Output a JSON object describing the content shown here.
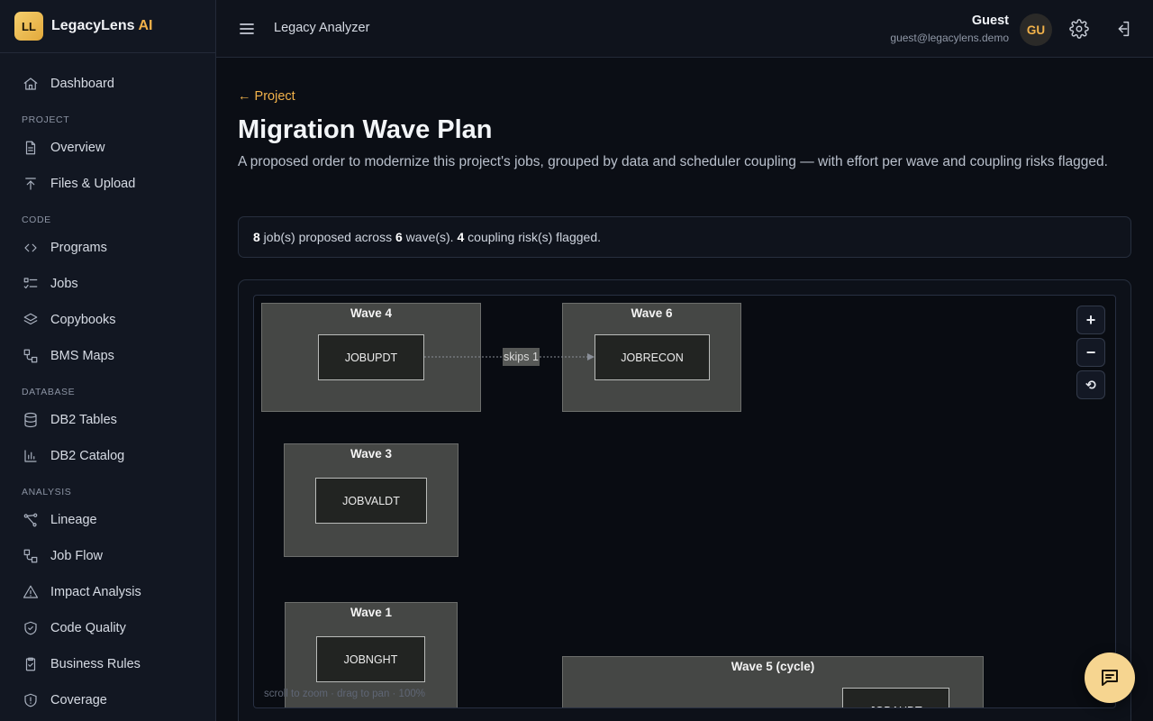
{
  "brand": {
    "logo": "LL",
    "name": "LegacyLens",
    "suffix": "AI"
  },
  "sidebar": {
    "dashboard": "Dashboard",
    "sections": {
      "project": "PROJECT",
      "code": "CODE",
      "database": "DATABASE",
      "analysis": "ANALYSIS"
    },
    "items": {
      "overview": "Overview",
      "files": "Files & Upload",
      "programs": "Programs",
      "jobs": "Jobs",
      "copybooks": "Copybooks",
      "bms": "BMS Maps",
      "db2tables": "DB2 Tables",
      "db2catalog": "DB2 Catalog",
      "lineage": "Lineage",
      "jobflow": "Job Flow",
      "impact": "Impact Analysis",
      "quality": "Code Quality",
      "rules": "Business Rules",
      "coverage": "Coverage"
    }
  },
  "topbar": {
    "title": "Legacy Analyzer",
    "user_name": "Guest",
    "user_email": "guest@legacylens.demo",
    "avatar": "GU"
  },
  "main": {
    "back": "← Project",
    "title": "Migration Wave Plan",
    "description": "A proposed order to modernize this project's jobs, grouped by data and scheduler coupling — with effort per wave and coupling risks flagged.",
    "summary": {
      "jobs": "8",
      "t1": " job(s) proposed across ",
      "waves": "6",
      "t2": " wave(s). ",
      "risks": "4",
      "t3": " coupling risk(s) flagged."
    }
  },
  "graph": {
    "waves": {
      "w4": "Wave 4",
      "w6": "Wave 6",
      "w3": "Wave 3",
      "w1": "Wave 1",
      "w5": "Wave 5 (cycle)"
    },
    "jobs": {
      "jobupdt": "JOBUPDT",
      "jobrecon": "JOBRECON",
      "jobvaldt": "JOBVALDT",
      "jobnght": "JOBNGHT",
      "jobaudt": "JOBAUDT"
    },
    "edge_label": "skips 1",
    "controls": {
      "zoom_in": "+",
      "zoom_out": "−",
      "reset": "⟲"
    },
    "hint": "scroll to zoom · drag to pan · 100%"
  }
}
